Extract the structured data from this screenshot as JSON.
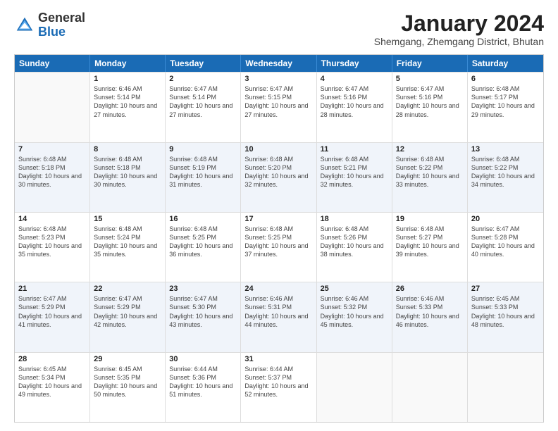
{
  "header": {
    "logo_general": "General",
    "logo_blue": "Blue",
    "month_year": "January 2024",
    "location": "Shemgang, Zhemgang District, Bhutan"
  },
  "weekdays": [
    "Sunday",
    "Monday",
    "Tuesday",
    "Wednesday",
    "Thursday",
    "Friday",
    "Saturday"
  ],
  "rows": [
    [
      {
        "day": "",
        "sunrise": "",
        "sunset": "",
        "daylight": "",
        "empty": true
      },
      {
        "day": "1",
        "sunrise": "Sunrise: 6:46 AM",
        "sunset": "Sunset: 5:14 PM",
        "daylight": "Daylight: 10 hours and 27 minutes."
      },
      {
        "day": "2",
        "sunrise": "Sunrise: 6:47 AM",
        "sunset": "Sunset: 5:14 PM",
        "daylight": "Daylight: 10 hours and 27 minutes."
      },
      {
        "day": "3",
        "sunrise": "Sunrise: 6:47 AM",
        "sunset": "Sunset: 5:15 PM",
        "daylight": "Daylight: 10 hours and 27 minutes."
      },
      {
        "day": "4",
        "sunrise": "Sunrise: 6:47 AM",
        "sunset": "Sunset: 5:16 PM",
        "daylight": "Daylight: 10 hours and 28 minutes."
      },
      {
        "day": "5",
        "sunrise": "Sunrise: 6:47 AM",
        "sunset": "Sunset: 5:16 PM",
        "daylight": "Daylight: 10 hours and 28 minutes."
      },
      {
        "day": "6",
        "sunrise": "Sunrise: 6:48 AM",
        "sunset": "Sunset: 5:17 PM",
        "daylight": "Daylight: 10 hours and 29 minutes."
      }
    ],
    [
      {
        "day": "7",
        "sunrise": "Sunrise: 6:48 AM",
        "sunset": "Sunset: 5:18 PM",
        "daylight": "Daylight: 10 hours and 30 minutes."
      },
      {
        "day": "8",
        "sunrise": "Sunrise: 6:48 AM",
        "sunset": "Sunset: 5:18 PM",
        "daylight": "Daylight: 10 hours and 30 minutes."
      },
      {
        "day": "9",
        "sunrise": "Sunrise: 6:48 AM",
        "sunset": "Sunset: 5:19 PM",
        "daylight": "Daylight: 10 hours and 31 minutes."
      },
      {
        "day": "10",
        "sunrise": "Sunrise: 6:48 AM",
        "sunset": "Sunset: 5:20 PM",
        "daylight": "Daylight: 10 hours and 32 minutes."
      },
      {
        "day": "11",
        "sunrise": "Sunrise: 6:48 AM",
        "sunset": "Sunset: 5:21 PM",
        "daylight": "Daylight: 10 hours and 32 minutes."
      },
      {
        "day": "12",
        "sunrise": "Sunrise: 6:48 AM",
        "sunset": "Sunset: 5:22 PM",
        "daylight": "Daylight: 10 hours and 33 minutes."
      },
      {
        "day": "13",
        "sunrise": "Sunrise: 6:48 AM",
        "sunset": "Sunset: 5:22 PM",
        "daylight": "Daylight: 10 hours and 34 minutes."
      }
    ],
    [
      {
        "day": "14",
        "sunrise": "Sunrise: 6:48 AM",
        "sunset": "Sunset: 5:23 PM",
        "daylight": "Daylight: 10 hours and 35 minutes."
      },
      {
        "day": "15",
        "sunrise": "Sunrise: 6:48 AM",
        "sunset": "Sunset: 5:24 PM",
        "daylight": "Daylight: 10 hours and 35 minutes."
      },
      {
        "day": "16",
        "sunrise": "Sunrise: 6:48 AM",
        "sunset": "Sunset: 5:25 PM",
        "daylight": "Daylight: 10 hours and 36 minutes."
      },
      {
        "day": "17",
        "sunrise": "Sunrise: 6:48 AM",
        "sunset": "Sunset: 5:25 PM",
        "daylight": "Daylight: 10 hours and 37 minutes."
      },
      {
        "day": "18",
        "sunrise": "Sunrise: 6:48 AM",
        "sunset": "Sunset: 5:26 PM",
        "daylight": "Daylight: 10 hours and 38 minutes."
      },
      {
        "day": "19",
        "sunrise": "Sunrise: 6:48 AM",
        "sunset": "Sunset: 5:27 PM",
        "daylight": "Daylight: 10 hours and 39 minutes."
      },
      {
        "day": "20",
        "sunrise": "Sunrise: 6:47 AM",
        "sunset": "Sunset: 5:28 PM",
        "daylight": "Daylight: 10 hours and 40 minutes."
      }
    ],
    [
      {
        "day": "21",
        "sunrise": "Sunrise: 6:47 AM",
        "sunset": "Sunset: 5:29 PM",
        "daylight": "Daylight: 10 hours and 41 minutes."
      },
      {
        "day": "22",
        "sunrise": "Sunrise: 6:47 AM",
        "sunset": "Sunset: 5:29 PM",
        "daylight": "Daylight: 10 hours and 42 minutes."
      },
      {
        "day": "23",
        "sunrise": "Sunrise: 6:47 AM",
        "sunset": "Sunset: 5:30 PM",
        "daylight": "Daylight: 10 hours and 43 minutes."
      },
      {
        "day": "24",
        "sunrise": "Sunrise: 6:46 AM",
        "sunset": "Sunset: 5:31 PM",
        "daylight": "Daylight: 10 hours and 44 minutes."
      },
      {
        "day": "25",
        "sunrise": "Sunrise: 6:46 AM",
        "sunset": "Sunset: 5:32 PM",
        "daylight": "Daylight: 10 hours and 45 minutes."
      },
      {
        "day": "26",
        "sunrise": "Sunrise: 6:46 AM",
        "sunset": "Sunset: 5:33 PM",
        "daylight": "Daylight: 10 hours and 46 minutes."
      },
      {
        "day": "27",
        "sunrise": "Sunrise: 6:45 AM",
        "sunset": "Sunset: 5:33 PM",
        "daylight": "Daylight: 10 hours and 48 minutes."
      }
    ],
    [
      {
        "day": "28",
        "sunrise": "Sunrise: 6:45 AM",
        "sunset": "Sunset: 5:34 PM",
        "daylight": "Daylight: 10 hours and 49 minutes."
      },
      {
        "day": "29",
        "sunrise": "Sunrise: 6:45 AM",
        "sunset": "Sunset: 5:35 PM",
        "daylight": "Daylight: 10 hours and 50 minutes."
      },
      {
        "day": "30",
        "sunrise": "Sunrise: 6:44 AM",
        "sunset": "Sunset: 5:36 PM",
        "daylight": "Daylight: 10 hours and 51 minutes."
      },
      {
        "day": "31",
        "sunrise": "Sunrise: 6:44 AM",
        "sunset": "Sunset: 5:37 PM",
        "daylight": "Daylight: 10 hours and 52 minutes."
      },
      {
        "day": "",
        "empty": true
      },
      {
        "day": "",
        "empty": true
      },
      {
        "day": "",
        "empty": true
      }
    ]
  ]
}
